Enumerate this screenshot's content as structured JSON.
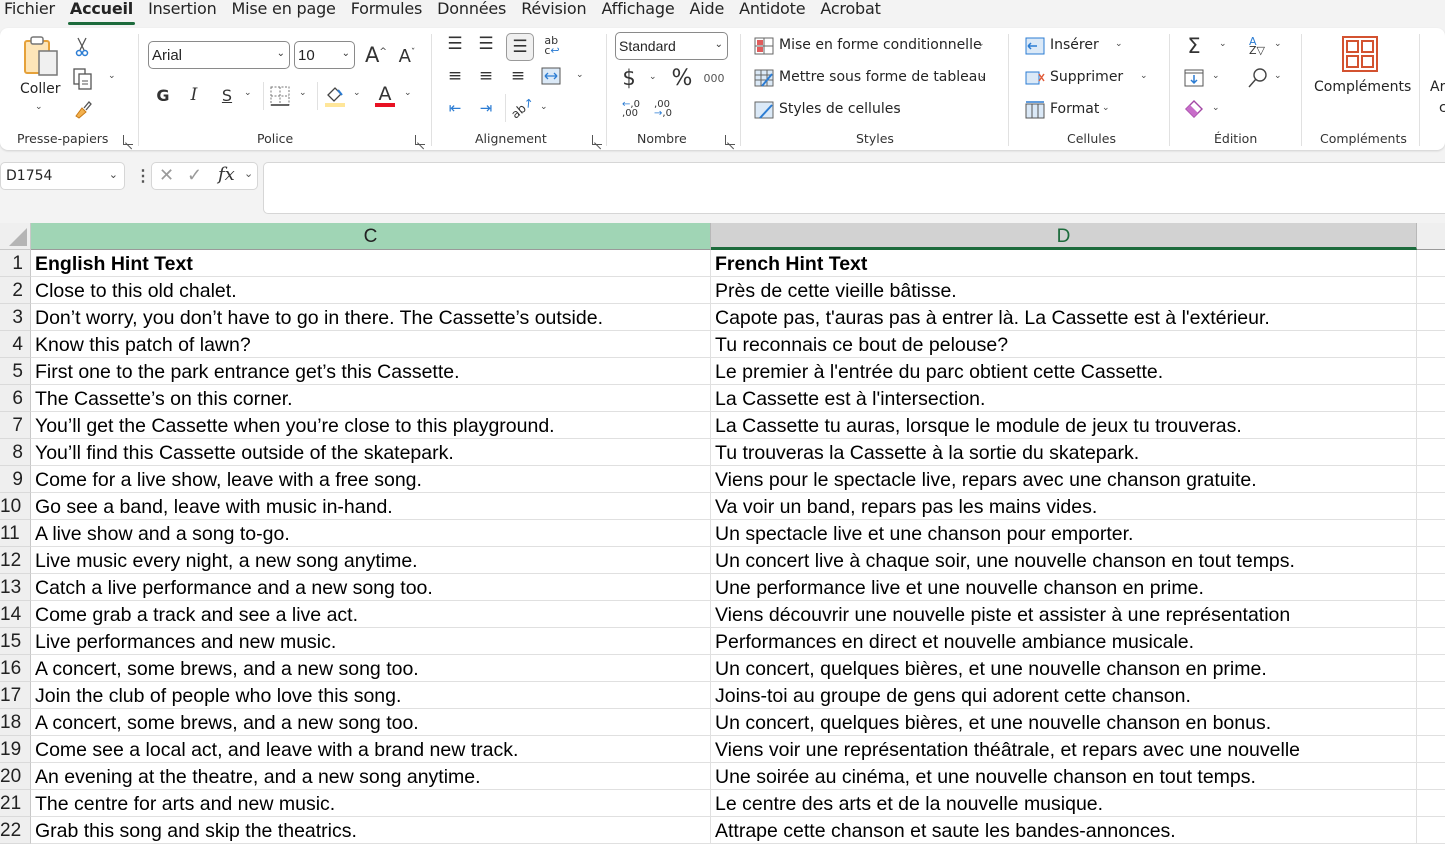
{
  "menu": {
    "tabs": [
      {
        "label": "Fichier",
        "active": false
      },
      {
        "label": "Accueil",
        "active": true
      },
      {
        "label": "Insertion",
        "active": false
      },
      {
        "label": "Mise en page",
        "active": false
      },
      {
        "label": "Formules",
        "active": false
      },
      {
        "label": "Données",
        "active": false
      },
      {
        "label": "Révision",
        "active": false
      },
      {
        "label": "Affichage",
        "active": false
      },
      {
        "label": "Aide",
        "active": false
      },
      {
        "label": "Antidote",
        "active": false
      },
      {
        "label": "Acrobat",
        "active": false
      }
    ]
  },
  "ribbon": {
    "clipboard": {
      "group_label": "Presse-papiers",
      "paste_label": "Coller"
    },
    "font": {
      "group_label": "Police",
      "font_name": "Arial",
      "font_size": "10",
      "bold": "G",
      "italic": "I",
      "underline": "S",
      "font_color": "#e81123",
      "fill_color": "#ffe699"
    },
    "alignment": {
      "group_label": "Alignement"
    },
    "number": {
      "group_label": "Nombre",
      "format": "Standard",
      "currency": "$",
      "percent": "%",
      "thousands": "000"
    },
    "styles": {
      "group_label": "Styles",
      "conditional": "Mise en forme conditionnelle",
      "as_table": "Mettre sous forme de tableau",
      "cell_styles": "Styles de cellules"
    },
    "cells": {
      "group_label": "Cellules",
      "insert": "Insérer",
      "delete": "Supprimer",
      "format": "Format"
    },
    "editing": {
      "group_label": "Édition"
    },
    "addins": {
      "group_label": "Compléments",
      "button_label": "Compléments"
    },
    "partial": {
      "line1": "Ar",
      "line2": "c"
    }
  },
  "formula_bar": {
    "name_box": "D1754",
    "fx": "fx",
    "formula": ""
  },
  "grid": {
    "columns": [
      {
        "letter": "C",
        "state": "highlighted"
      },
      {
        "letter": "D",
        "state": "selected"
      }
    ],
    "rows": [
      {
        "num": "1",
        "c": "English Hint Text",
        "d": "French Hint Text"
      },
      {
        "num": "2",
        "c": "Close to this old chalet.",
        "d": "Près de cette vieille bâtisse."
      },
      {
        "num": "3",
        "c": "Don’t worry, you don’t have to go in there. The Cassette’s outside.",
        "d": "Capote pas, t'auras pas à entrer là. La Cassette est à l'extérieur."
      },
      {
        "num": "4",
        "c": "Know this patch of lawn?",
        "d": "Tu reconnais ce bout de pelouse?"
      },
      {
        "num": "5",
        "c": "First one to the park entrance get’s this Cassette.",
        "d": "Le premier à l'entrée du parc obtient cette Cassette."
      },
      {
        "num": "6",
        "c": "The Cassette’s on this corner.",
        "d": "La Cassette est à l'intersection."
      },
      {
        "num": "7",
        "c": "You’ll get the Cassette when you’re close to this playground.",
        "d": "La Cassette tu auras, lorsque le module de jeux tu trouveras."
      },
      {
        "num": "8",
        "c": "You’ll find this Cassette outside of the skatepark.",
        "d": "Tu trouveras la Cassette à la sortie du skatepark."
      },
      {
        "num": "9",
        "c": "Come for a live show, leave with a free song.",
        "d": "Viens pour le spectacle live, repars avec une chanson gratuite."
      },
      {
        "num": "10",
        "c": "Go see a band, leave with music in-hand.",
        "d": "Va voir un band, repars pas les mains vides."
      },
      {
        "num": "11",
        "c": "A live show and a song to-go.",
        "d": "Un spectacle live et une chanson pour emporter."
      },
      {
        "num": "12",
        "c": "Live music every night, a new song anytime.",
        "d": "Un concert live à chaque soir, une nouvelle chanson en tout temps."
      },
      {
        "num": "13",
        "c": "Catch a live performance and a new song too.",
        "d": "Une performance live et une nouvelle chanson en prime."
      },
      {
        "num": "14",
        "c": "Come grab a track and see a live act.",
        "d": "Viens découvrir une nouvelle piste et assister à une représentation"
      },
      {
        "num": "15",
        "c": "Live performances and new music.",
        "d": "Performances en direct et nouvelle ambiance musicale."
      },
      {
        "num": "16",
        "c": "A concert, some brews, and a new song too.",
        "d": "Un concert, quelques bières, et une nouvelle chanson en prime."
      },
      {
        "num": "17",
        "c": "Join the club of people who love this song.",
        "d": "Joins-toi au groupe de gens qui adorent cette chanson."
      },
      {
        "num": "18",
        "c": "A concert, some brews, and a new song too.",
        "d": "Un concert, quelques bières, et une nouvelle chanson en bonus."
      },
      {
        "num": "19",
        "c": "Come see a local act, and leave with a brand new track.",
        "d": "Viens voir une représentation théâtrale, et repars avec une nouvelle"
      },
      {
        "num": "20",
        "c": "An evening at the theatre, and a new song anytime.",
        "d": "Une soirée au cinéma, et une nouvelle chanson en tout temps."
      },
      {
        "num": "21",
        "c": "The centre for arts and new music.",
        "d": "Le centre des arts et de la nouvelle musique."
      },
      {
        "num": "22",
        "c": "Grab this song and skip the theatrics.",
        "d": "Attrape cette chanson et saute les bandes-annonces."
      }
    ]
  },
  "colors": {
    "accent_green": "#1d6b3c",
    "col_c_header": "#a0d5b5",
    "col_d_header": "#d2d2d2",
    "addins_orange": "#d35230"
  }
}
